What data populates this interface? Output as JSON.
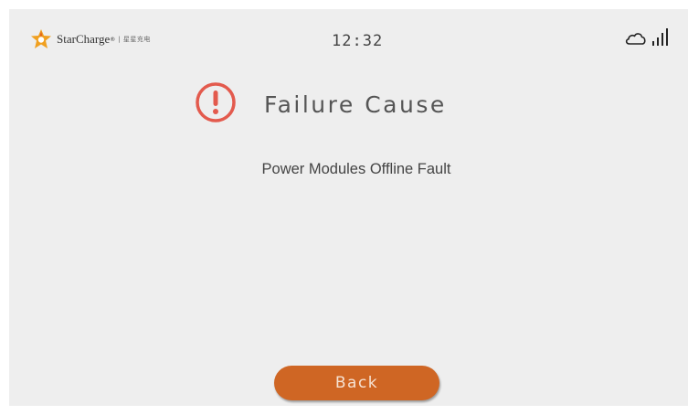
{
  "header": {
    "brand_name": "StarCharge",
    "brand_mark": "®",
    "brand_sub": "| 星星充电",
    "time": "12:32",
    "icons": {
      "logo": "starcharge-logo-icon",
      "cloud": "cloud-icon",
      "signal": "signal-bars-icon"
    }
  },
  "main": {
    "title": "Failure Cause",
    "title_icon": "exclamation-circle-icon",
    "cause": "Power Modules Offline Fault"
  },
  "footer": {
    "back_label": "Back"
  },
  "colors": {
    "background": "#eeeeee",
    "accent": "#cf6624",
    "alert": "#e35a4d",
    "logo": "#f0a020"
  }
}
